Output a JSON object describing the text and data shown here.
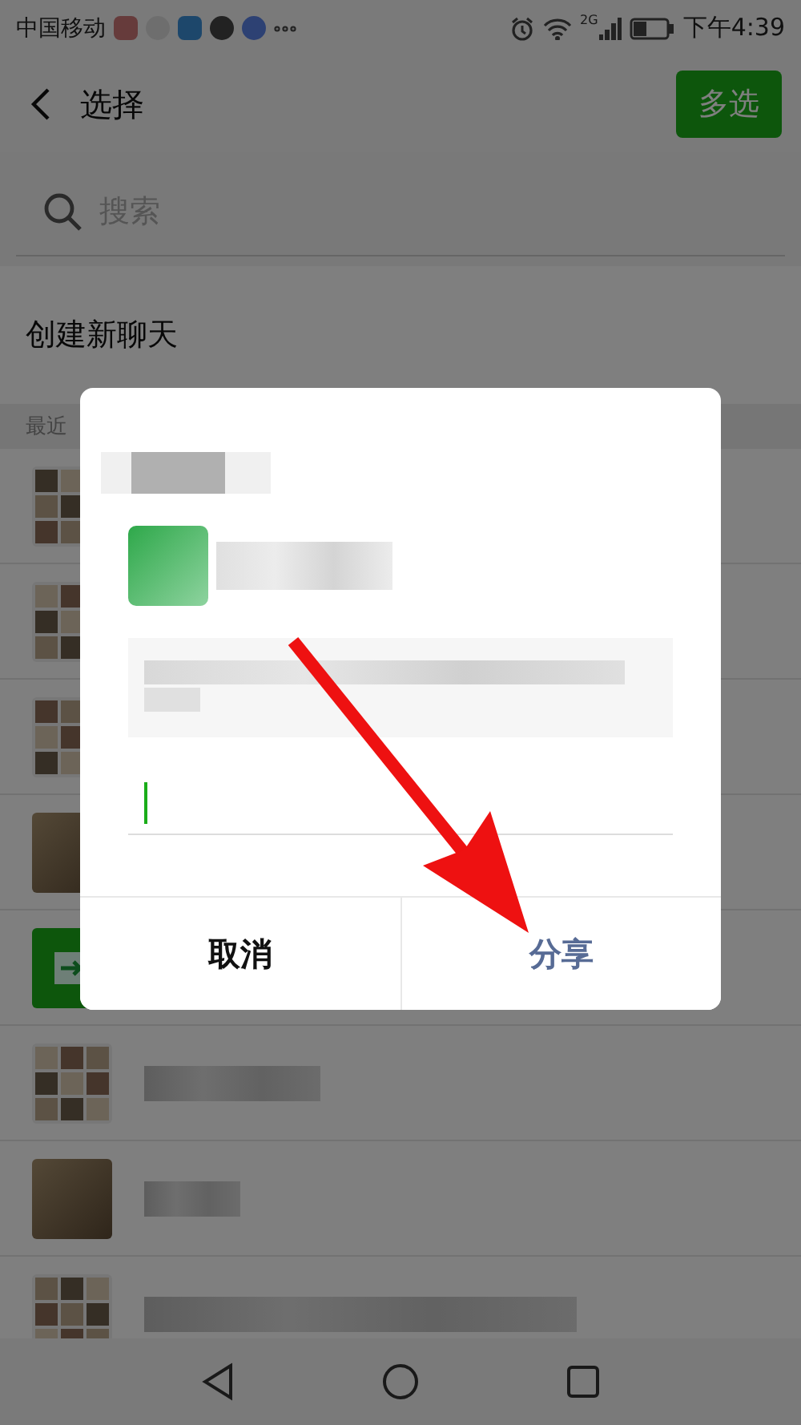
{
  "status_bar": {
    "carrier": "中国移动",
    "network": "2G",
    "time": "下午4:39"
  },
  "header": {
    "title": "选择",
    "action": "多选"
  },
  "search": {
    "placeholder": "搜索"
  },
  "new_chat": "创建新聊天",
  "section_header": "最近",
  "chats": [
    {
      "kind": "group"
    },
    {
      "kind": "group"
    },
    {
      "kind": "group"
    },
    {
      "kind": "photo"
    },
    {
      "kind": "file"
    },
    {
      "kind": "group"
    },
    {
      "kind": "photo"
    },
    {
      "kind": "group"
    }
  ],
  "dialog": {
    "buttons": [
      {
        "label": "取消",
        "kind": "cancel"
      },
      {
        "label": "分享",
        "kind": "confirm"
      }
    ]
  }
}
